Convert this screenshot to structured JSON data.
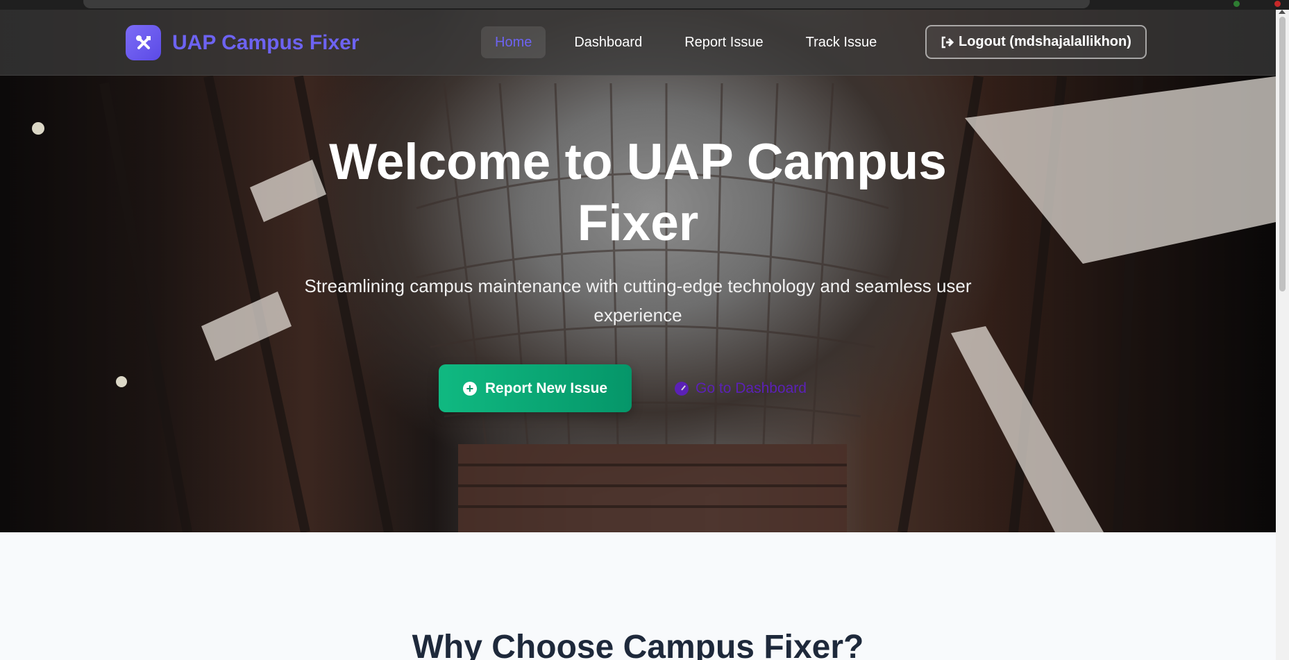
{
  "brand": {
    "name": "UAP Campus Fixer",
    "logo_icon": "tools-icon",
    "accent": "#6d63f2"
  },
  "nav": {
    "links": [
      {
        "label": "Home",
        "active": true
      },
      {
        "label": "Dashboard",
        "active": false
      },
      {
        "label": "Report Issue",
        "active": false
      },
      {
        "label": "Track Issue",
        "active": false
      }
    ],
    "logout_label": "Logout (mdshajalallikhon)",
    "logout_icon": "sign-out-icon"
  },
  "hero": {
    "title": "Welcome to UAP Campus Fixer",
    "subtitle": "Streamlining campus maintenance with cutting-edge technology and seamless user experience",
    "primary_button": {
      "label": "Report New Issue",
      "icon": "plus-circle-icon",
      "color": "#10b981"
    },
    "secondary_button": {
      "label": "Go to Dashboard",
      "icon": "gauge-icon",
      "color": "#5b21b6"
    }
  },
  "features": {
    "title": "Why Choose Campus Fixer?"
  }
}
